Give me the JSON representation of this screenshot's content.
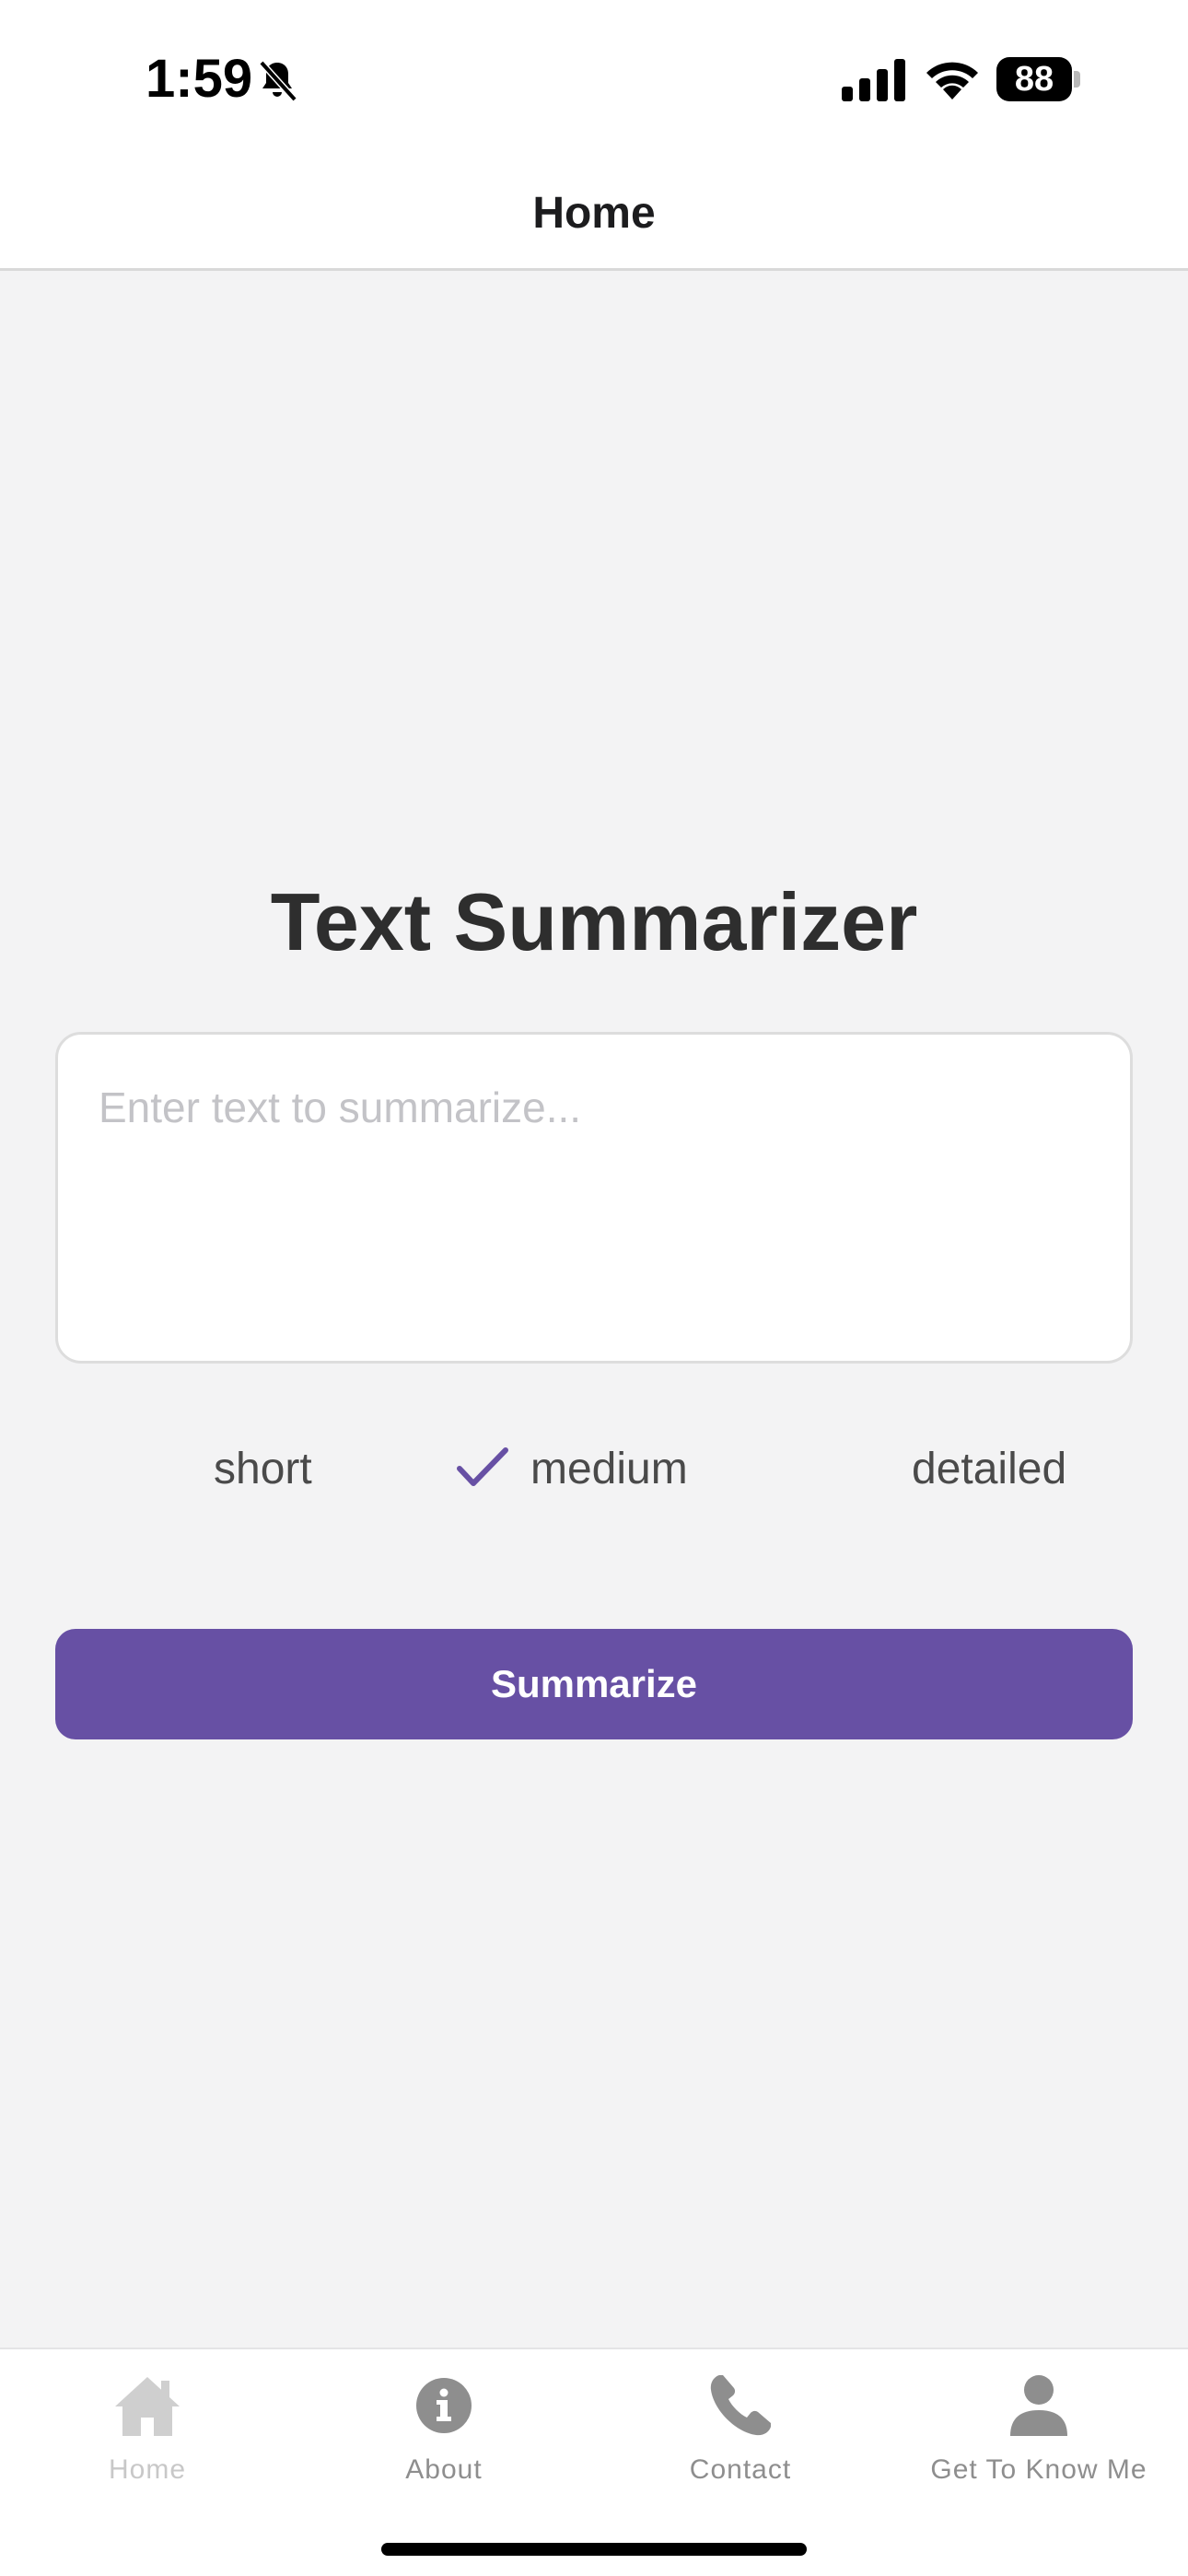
{
  "status_bar": {
    "time": "1:59",
    "battery": "88",
    "icons": [
      "bell-slash-icon",
      "signal-icon",
      "wifi-icon",
      "battery-icon"
    ]
  },
  "header": {
    "title": "Home"
  },
  "main": {
    "title": "Text Summarizer",
    "input": {
      "value": "",
      "placeholder": "Enter text to summarize..."
    },
    "length_options": [
      {
        "label": "short",
        "selected": false
      },
      {
        "label": "medium",
        "selected": true
      },
      {
        "label": "detailed",
        "selected": false
      }
    ],
    "button_label": "Summarize"
  },
  "tab_bar": {
    "tabs": [
      {
        "label": "Home",
        "icon": "home-icon",
        "active": true
      },
      {
        "label": "About",
        "icon": "info-icon",
        "active": false
      },
      {
        "label": "Contact",
        "icon": "phone-icon",
        "active": false
      },
      {
        "label": "Get To Know Me",
        "icon": "person-icon",
        "active": false
      }
    ]
  },
  "colors": {
    "accent": "#6750a4",
    "background": "#f3f3f4",
    "tab_inactive": "#8e8e8e",
    "tab_active": "#c8c8c8"
  }
}
